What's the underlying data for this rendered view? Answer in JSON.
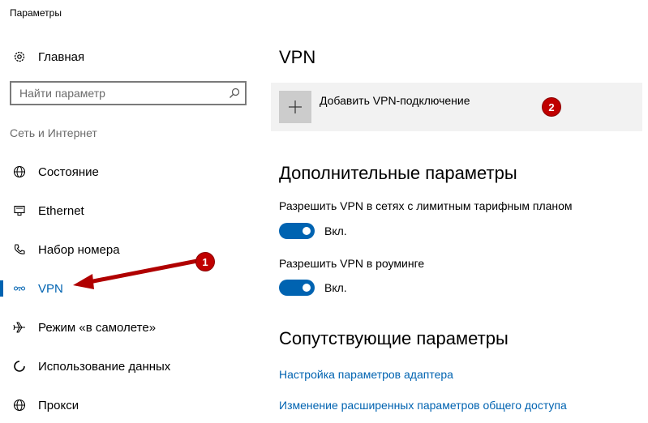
{
  "window": {
    "title": "Параметры"
  },
  "sidebar": {
    "home_label": "Главная",
    "search_placeholder": "Найти параметр",
    "section_label": "Сеть и Интернет",
    "items": [
      {
        "label": "Состояние",
        "icon": "globe-icon"
      },
      {
        "label": "Ethernet",
        "icon": "ethernet-icon"
      },
      {
        "label": "Набор номера",
        "icon": "phone-icon"
      },
      {
        "label": "VPN",
        "icon": "vpn-icon",
        "active": true
      },
      {
        "label": "Режим «в самолете»",
        "icon": "airplane-icon"
      },
      {
        "label": "Использование данных",
        "icon": "data-usage-icon"
      },
      {
        "label": "Прокси",
        "icon": "globe-icon"
      }
    ]
  },
  "main": {
    "title": "VPN",
    "add_vpn_label": "Добавить VPN-подключение",
    "advanced": {
      "title": "Дополнительные параметры",
      "settings": [
        {
          "label": "Разрешить VPN в сетях с лимитным тарифным планом",
          "state": "Вкл."
        },
        {
          "label": "Разрешить VPN в роуминге",
          "state": "Вкл."
        }
      ]
    },
    "related": {
      "title": "Сопутствующие параметры",
      "links": [
        "Настройка параметров адаптера",
        "Изменение расширенных параметров общего доступа"
      ]
    }
  },
  "annotations": {
    "badge1": "1",
    "badge2": "2"
  },
  "colors": {
    "accent": "#0063b1",
    "annotation": "#c00000"
  }
}
